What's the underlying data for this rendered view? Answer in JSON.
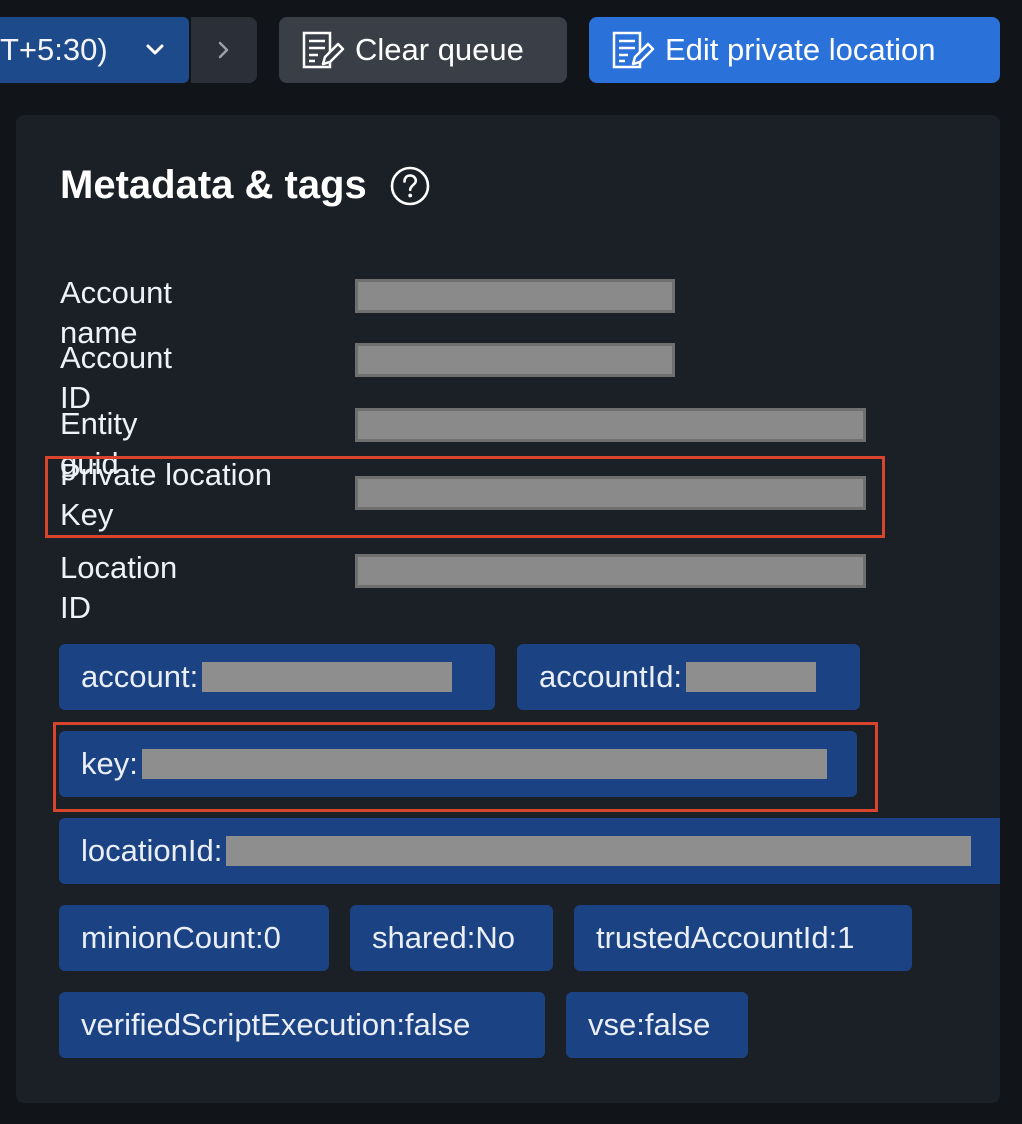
{
  "toolbar": {
    "timezone_label": "T+5:30)",
    "timezone_chevron_icon": "chevron-down-icon",
    "next_icon": "chevron-right-icon",
    "clear_queue_label": "Clear queue",
    "clear_queue_icon": "edit-document-icon",
    "edit_location_label": "Edit private location",
    "edit_location_icon": "edit-document-icon"
  },
  "panel": {
    "title": "Metadata & tags",
    "help_icon": "question-circle-icon",
    "fields": [
      {
        "label": "Account name"
      },
      {
        "label": "Account ID"
      },
      {
        "label": "Entity guid"
      },
      {
        "label": "Private location\nKey"
      },
      {
        "label": "Location ID"
      }
    ],
    "tags": [
      {
        "text": "account:"
      },
      {
        "text": "accountId:"
      },
      {
        "text": "key:"
      },
      {
        "text": "locationId:"
      },
      {
        "text": "minionCount:0"
      },
      {
        "text": "shared:No"
      },
      {
        "text": "trustedAccountId:1"
      },
      {
        "text": "verifiedScriptExecution:false"
      },
      {
        "text": "vse:false"
      }
    ]
  },
  "colors": {
    "primary_button": "#2a71d9",
    "tag_background": "#1b4282",
    "highlight_border": "#d9442c",
    "card_background": "#1b1f26"
  }
}
